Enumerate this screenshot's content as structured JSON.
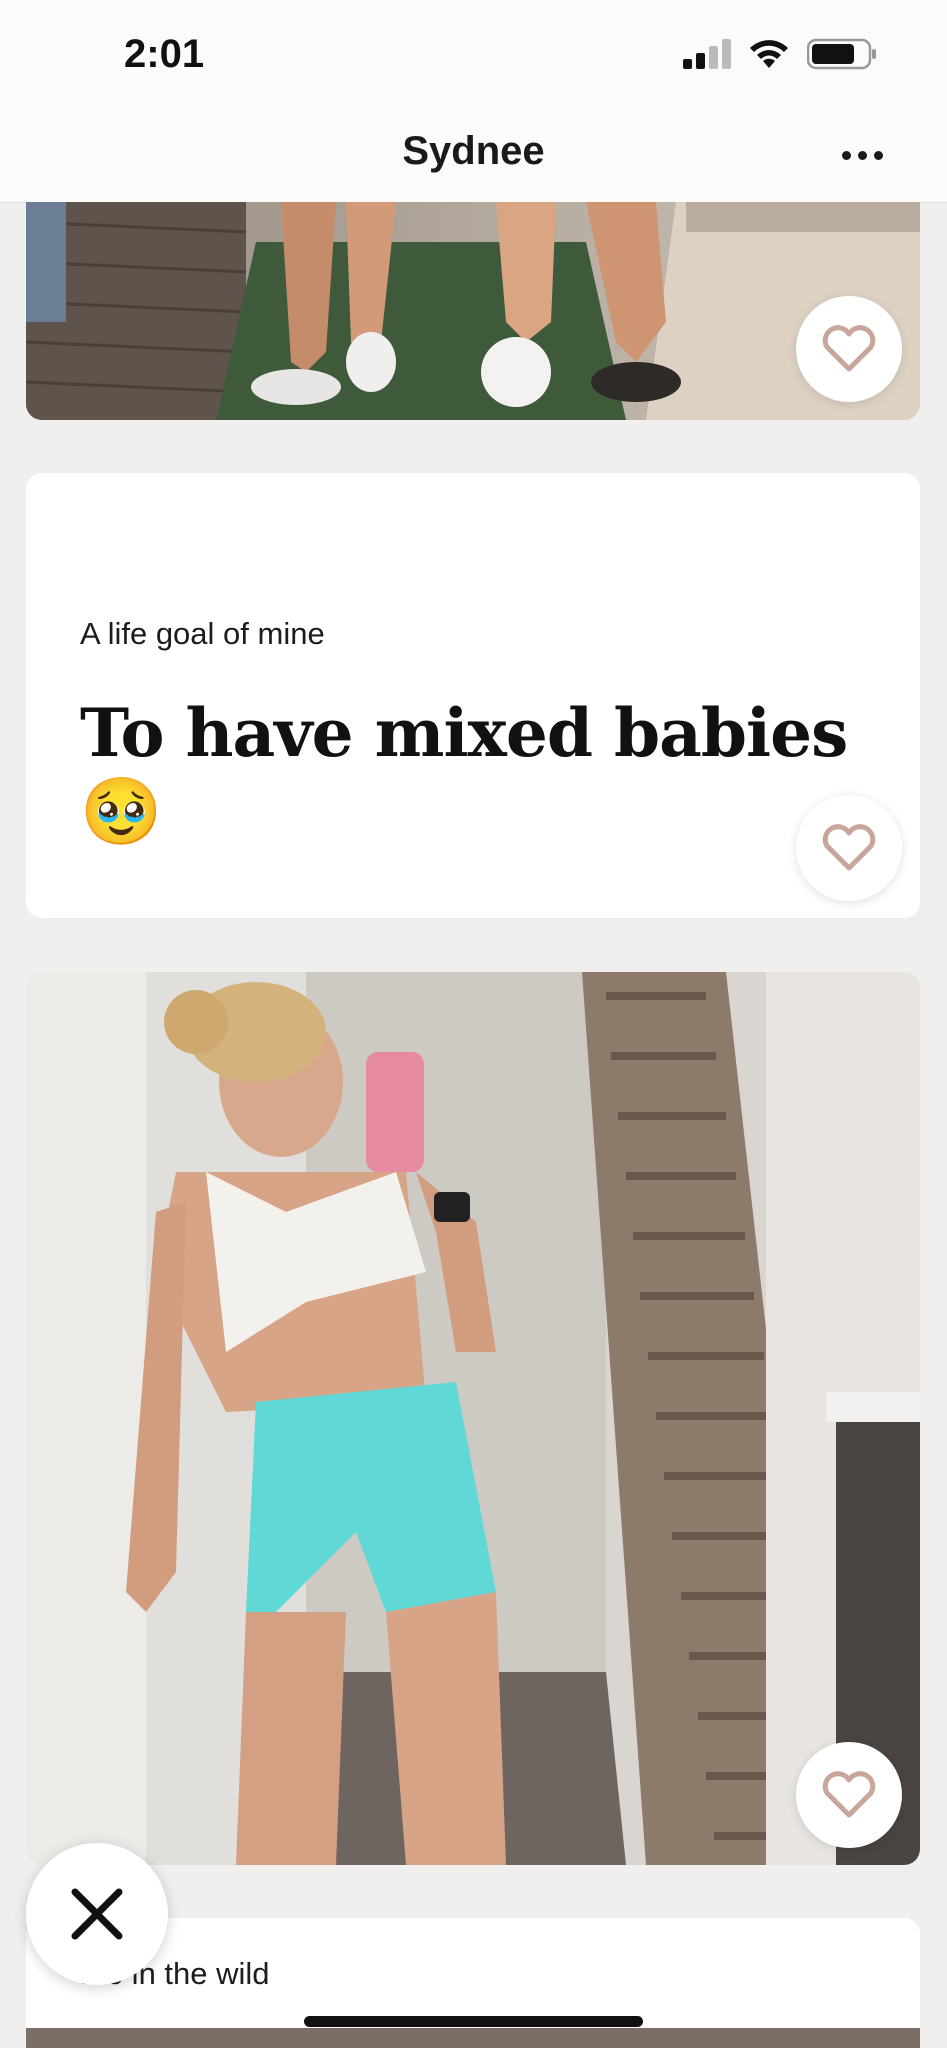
{
  "status_bar": {
    "time": "2:01",
    "icons": [
      "cellular-signal-icon",
      "wifi-icon",
      "battery-icon"
    ]
  },
  "header": {
    "title": "Sydnee",
    "menu_icon": "more-horizontal-icon"
  },
  "cards": {
    "top_photo": {
      "image": "photo-feet-sandals",
      "like_icon": "heart-outline-icon"
    },
    "prompt": {
      "label": "A life goal of mine",
      "answer": "To have mixed babies 🥹",
      "like_icon": "heart-outline-icon"
    },
    "main_photo": {
      "image": "photo-mirror-selfie",
      "like_icon": "heart-outline-icon"
    },
    "bottom_prompt": {
      "label": "Me in the wild"
    }
  },
  "actions": {
    "pass_icon": "close-x-icon"
  },
  "colors": {
    "background": "#f0efee",
    "card": "#ffffff",
    "heart": "#c9a69b",
    "text": "#111111"
  }
}
